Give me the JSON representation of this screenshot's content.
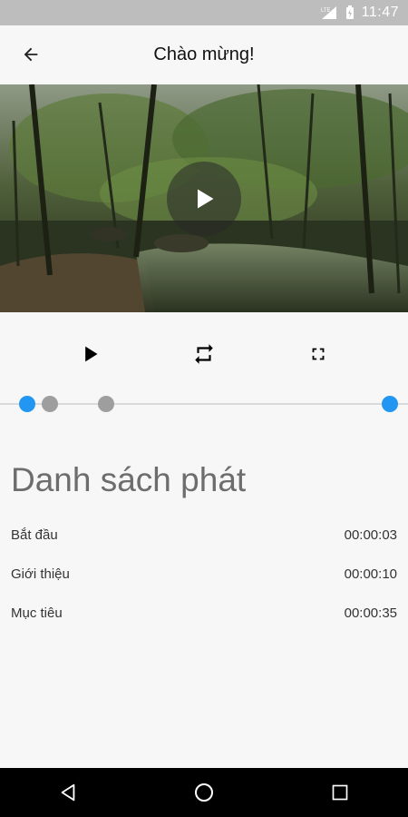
{
  "status_bar": {
    "network": "LTE",
    "time": "11:47"
  },
  "app_bar": {
    "title": "Chào mừng!",
    "back_icon": "arrow-left-icon"
  },
  "video": {
    "state": "paused",
    "overlay_icon": "play-icon"
  },
  "controls": {
    "play_icon": "play-icon",
    "repeat_icon": "repeat-icon",
    "fullscreen_icon": "fullscreen-icon"
  },
  "timeline": {
    "markers": [
      {
        "color": "#2196f3",
        "role": "start"
      },
      {
        "color": "#9e9e9e",
        "role": "chapter"
      },
      {
        "color": "#9e9e9e",
        "role": "chapter"
      },
      {
        "color": "#2196f3",
        "role": "end"
      }
    ]
  },
  "playlist": {
    "heading": "Danh sách phát",
    "items": [
      {
        "label": "Bắt đầu",
        "time": "00:00:03"
      },
      {
        "label": "Giới thiệu",
        "time": "00:00:10"
      },
      {
        "label": "Mục tiêu",
        "time": "00:00:35"
      }
    ]
  },
  "nav_bar": {
    "back_icon": "nav-back-icon",
    "home_icon": "nav-home-icon",
    "recents_icon": "nav-recents-icon"
  },
  "colors": {
    "accent": "#2196f3",
    "marker_grey": "#9e9e9e",
    "status_bar": "#bdbdbd",
    "nav_bar": "#000000",
    "background": "#f7f7f7"
  }
}
